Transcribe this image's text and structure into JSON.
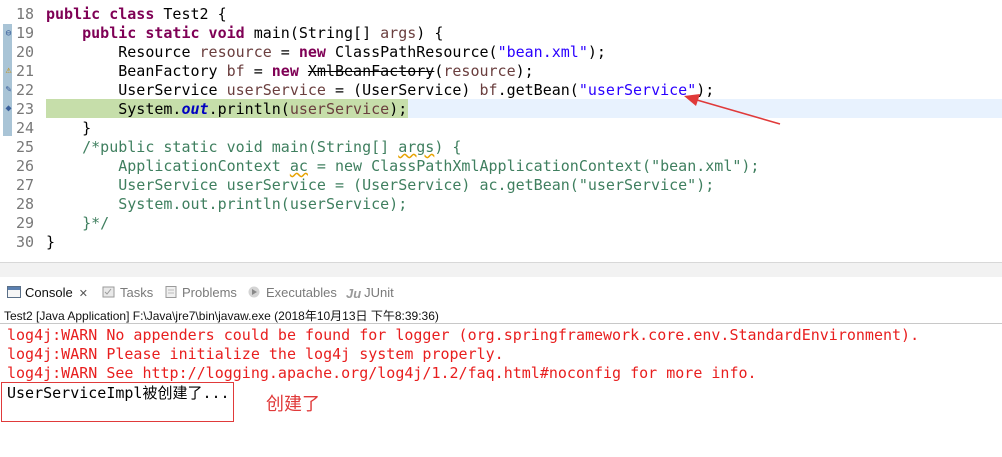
{
  "editor": {
    "lines": [
      {
        "num": "18",
        "tokens": [
          {
            "t": "public class ",
            "c": "kw"
          },
          {
            "t": "Test2 {",
            "c": ""
          }
        ]
      },
      {
        "num": "19",
        "tokens": [
          {
            "t": "    ",
            "c": ""
          },
          {
            "t": "public static void ",
            "c": "kw"
          },
          {
            "t": "main(String[] ",
            "c": ""
          },
          {
            "t": "args",
            "c": "var"
          },
          {
            "t": ") {",
            "c": ""
          }
        ]
      },
      {
        "num": "20",
        "tokens": [
          {
            "t": "        Resource ",
            "c": ""
          },
          {
            "t": "resource",
            "c": "var"
          },
          {
            "t": " = ",
            "c": ""
          },
          {
            "t": "new ",
            "c": "kw"
          },
          {
            "t": "ClassPathResource(",
            "c": ""
          },
          {
            "t": "\"bean.xml\"",
            "c": "str"
          },
          {
            "t": ");",
            "c": ""
          }
        ]
      },
      {
        "num": "21",
        "tokens": [
          {
            "t": "        BeanFactory ",
            "c": ""
          },
          {
            "t": "bf",
            "c": "var"
          },
          {
            "t": " = ",
            "c": ""
          },
          {
            "t": "new ",
            "c": "kw"
          },
          {
            "t": "XmlBeanFactory",
            "c": "strike"
          },
          {
            "t": "(",
            "c": ""
          },
          {
            "t": "resource",
            "c": "var"
          },
          {
            "t": ");",
            "c": ""
          }
        ]
      },
      {
        "num": "22",
        "tokens": [
          {
            "t": "        UserService ",
            "c": ""
          },
          {
            "t": "userService",
            "c": "var"
          },
          {
            "t": " = (UserService) ",
            "c": ""
          },
          {
            "t": "bf",
            "c": "var"
          },
          {
            "t": ".getBean(",
            "c": ""
          },
          {
            "t": "\"userService\"",
            "c": "str"
          },
          {
            "t": ");",
            "c": ""
          }
        ]
      },
      {
        "num": "23",
        "tokens": [
          {
            "t": "        System.",
            "c": ""
          },
          {
            "t": "out",
            "c": "fld"
          },
          {
            "t": ".println(",
            "c": ""
          },
          {
            "t": "userService",
            "c": "var"
          },
          {
            "t": ");",
            "c": ""
          }
        ]
      },
      {
        "num": "24",
        "tokens": [
          {
            "t": "    }",
            "c": ""
          }
        ]
      },
      {
        "num": "25",
        "tokens": [
          {
            "t": "    /*public static void main(String[] ",
            "c": "cmt"
          },
          {
            "t": "args",
            "c": "cmt squig"
          },
          {
            "t": ") {",
            "c": "cmt"
          }
        ]
      },
      {
        "num": "26",
        "tokens": [
          {
            "t": "        ApplicationContext ",
            "c": "cmt"
          },
          {
            "t": "ac",
            "c": "cmt squig"
          },
          {
            "t": " = new ClassPathXmlApplicationContext(\"bean.xml\");",
            "c": "cmt"
          }
        ]
      },
      {
        "num": "27",
        "tokens": [
          {
            "t": "        UserService userService = (UserService) ac.getBean(\"userService\");",
            "c": "cmt"
          }
        ]
      },
      {
        "num": "28",
        "tokens": [
          {
            "t": "        System.out.println(userService);",
            "c": "cmt"
          }
        ]
      },
      {
        "num": "29",
        "tokens": [
          {
            "t": "    }*/",
            "c": "cmt"
          }
        ]
      },
      {
        "num": "30",
        "tokens": [
          {
            "t": "}",
            "c": ""
          }
        ]
      }
    ]
  },
  "console_tabs": [
    {
      "label": "Console",
      "icon": "console-icon",
      "active": true,
      "closable": true
    },
    {
      "label": "Tasks",
      "icon": "tasks-icon",
      "active": false
    },
    {
      "label": "Problems",
      "icon": "problems-icon",
      "active": false
    },
    {
      "label": "Executables",
      "icon": "executables-icon",
      "active": false
    },
    {
      "label": "JUnit",
      "icon": "junit-icon",
      "active": false
    }
  ],
  "run_info": "Test2 [Java Application] F:\\Java\\jre7\\bin\\javaw.exe (2018年10月13日 下午8:39:36)",
  "console_output": [
    {
      "text": "log4j:WARN No appenders could be found for logger (org.springframework.core.env.StandardEnvironment).",
      "kind": "err"
    },
    {
      "text": "log4j:WARN Please initialize the log4j system properly.",
      "kind": "err"
    },
    {
      "text": "log4j:WARN See http://logging.apache.org/log4j/1.2/faq.html#noconfig for more info.",
      "kind": "err"
    },
    {
      "text": "UserServiceImpl被创建了...",
      "kind": "normal"
    }
  ],
  "annotation_text": "创建了",
  "colors": {
    "keyword": "#7f0055",
    "string": "#2a00ff",
    "comment": "#3f7f5f",
    "error": "#e81e1e",
    "annotation": "#e03a3a",
    "current_line": "#c6deaa"
  }
}
